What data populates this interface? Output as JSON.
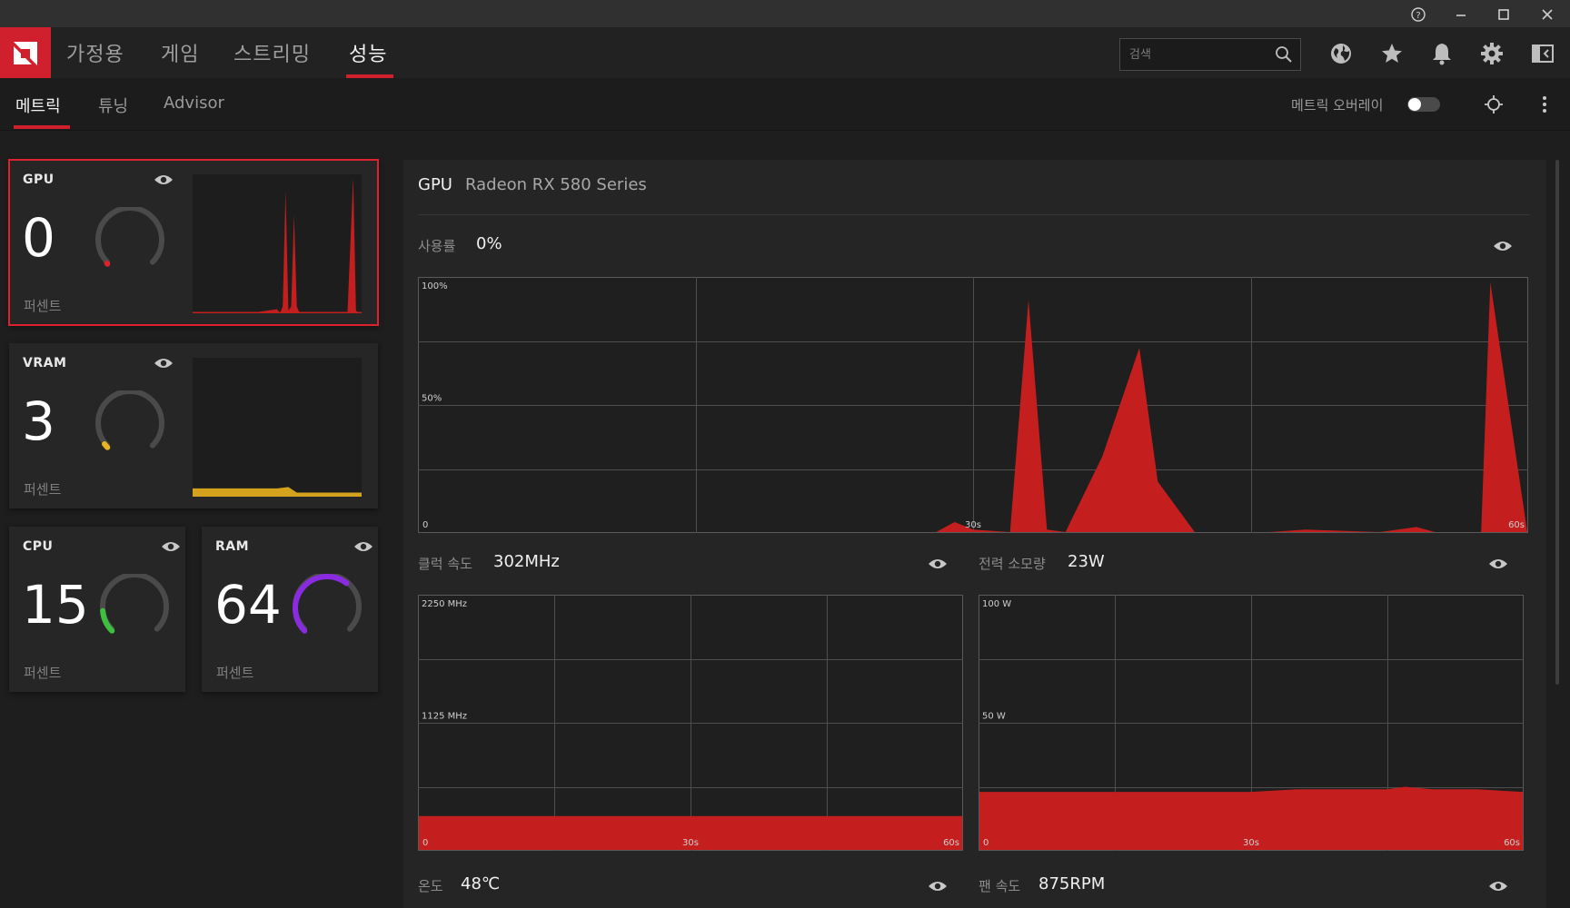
{
  "titlebar": {
    "help_icon": "help-circle-icon",
    "minimize_icon": "minimize-icon",
    "maximize_icon": "maximize-icon",
    "close_icon": "close-icon"
  },
  "topnav": {
    "tabs": [
      {
        "label": "가정용",
        "active": false
      },
      {
        "label": "게임",
        "active": false
      },
      {
        "label": "스트리밍",
        "active": false
      },
      {
        "label": "성능",
        "active": true
      }
    ],
    "search": {
      "placeholder": "검색",
      "value": ""
    },
    "icons": [
      "globe-icon",
      "star-icon",
      "bell-icon",
      "gear-icon",
      "layout-icon"
    ],
    "accent": "#d0202e"
  },
  "subnav": {
    "tabs": [
      {
        "label": "메트릭",
        "active": true
      },
      {
        "label": "튜닝",
        "active": false
      },
      {
        "label": "Advisor",
        "active": false
      }
    ],
    "overlay_label": "메트릭 오버레이",
    "overlay_on": false
  },
  "cards": {
    "gpu": {
      "title": "GPU",
      "value": "0",
      "unit": "퍼센트",
      "percent": 0,
      "color": "#e0202e"
    },
    "vram": {
      "title": "VRAM",
      "value": "3",
      "unit": "퍼센트",
      "percent": 3,
      "color": "#e8b321"
    },
    "cpu": {
      "title": "CPU",
      "value": "15",
      "unit": "퍼센트",
      "percent": 15,
      "color": "#3fbf3f"
    },
    "ram": {
      "title": "RAM",
      "value": "64",
      "unit": "퍼센트",
      "percent": 64,
      "color": "#8a2be2"
    }
  },
  "main": {
    "heading": "GPU",
    "model": "Radeon RX 580 Series",
    "usage": {
      "label": "사용률",
      "value": "0%"
    },
    "clock": {
      "label": "클럭 속도",
      "value": "302MHz"
    },
    "power": {
      "label": "전력 소모량",
      "value": "23W"
    },
    "temp": {
      "label": "온도",
      "value": "48℃"
    },
    "fan": {
      "label": "팬 속도",
      "value": "875RPM"
    }
  },
  "chart_data": [
    {
      "type": "area",
      "name": "usage",
      "ymax": 100,
      "ylabels": [
        "100%",
        "50%",
        "0"
      ],
      "xlabels": [
        "30s",
        "60s"
      ],
      "x": [
        0,
        18,
        20,
        22,
        24,
        25,
        26,
        28,
        29,
        30,
        32,
        33,
        34,
        35,
        37,
        39,
        40,
        42,
        44,
        46,
        48,
        52,
        54,
        55,
        56,
        57.5,
        58,
        60
      ],
      "y": [
        0,
        0,
        0,
        0,
        0,
        0,
        0,
        0,
        4,
        1,
        0,
        92,
        1,
        0,
        30,
        73,
        20,
        0,
        0,
        0,
        1,
        0,
        2,
        0,
        0,
        0,
        99,
        0
      ],
      "color": "#c41e1e"
    },
    {
      "type": "area",
      "name": "clock",
      "ymax": 2250,
      "ylabels": [
        "2250 MHz",
        "1125 MHz",
        "0"
      ],
      "xlabels": [
        "30s",
        "60s"
      ],
      "x": [
        0,
        60
      ],
      "y": [
        302,
        302
      ],
      "color": "#c41e1e"
    },
    {
      "type": "area",
      "name": "power",
      "ymax": 100,
      "ylabels": [
        "100 W",
        "50 W",
        "0"
      ],
      "xlabels": [
        "30s",
        "60s"
      ],
      "x": [
        0,
        10,
        20,
        30,
        35,
        40,
        45,
        47,
        50,
        55,
        60
      ],
      "y": [
        23,
        23,
        23,
        23,
        24,
        24,
        24,
        25,
        24,
        24,
        23
      ],
      "color": "#c41e1e"
    },
    {
      "type": "area",
      "name": "gpu-mini",
      "ymax": 100,
      "x": [
        0,
        20,
        30,
        31,
        32,
        33,
        34,
        35,
        36,
        37,
        38,
        45,
        50,
        55,
        57,
        58,
        59,
        60
      ],
      "y": [
        0,
        0,
        3,
        0,
        5,
        90,
        2,
        5,
        72,
        5,
        0,
        0,
        0,
        1,
        99,
        2,
        0,
        0
      ],
      "color": "#c41e1e"
    },
    {
      "type": "area",
      "name": "vram-mini",
      "ymax": 100,
      "x": [
        0,
        20,
        30,
        34,
        37,
        40,
        50,
        60
      ],
      "y": [
        6,
        6,
        6,
        7,
        3,
        3,
        3,
        3
      ],
      "color": "#d4a21c"
    }
  ]
}
